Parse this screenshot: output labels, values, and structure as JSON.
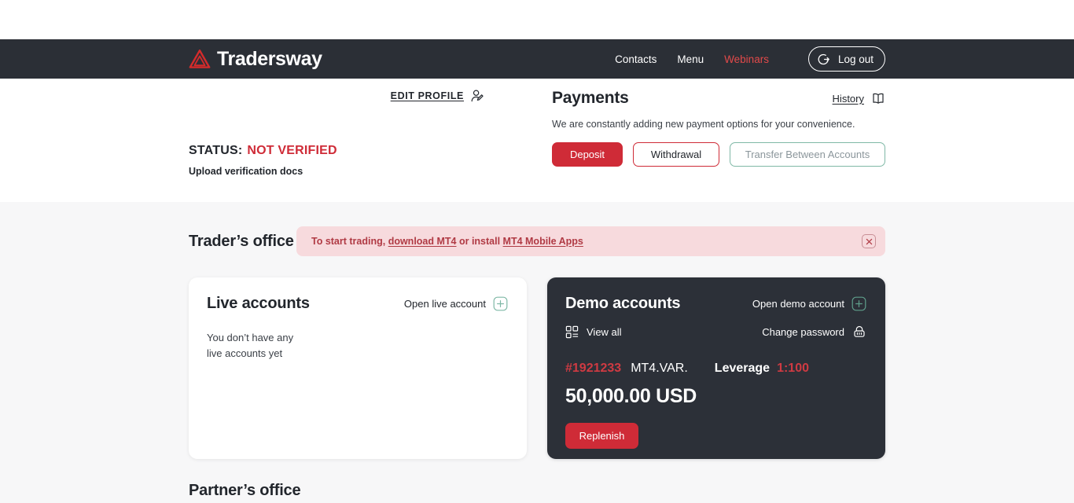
{
  "brand": {
    "name": "Tradersway",
    "logo_icon": "triangle-logo-icon",
    "accent_color": "#cf2b37"
  },
  "header": {
    "background_color": "#2b2f36",
    "nav": [
      {
        "label": "Contacts",
        "accent": false
      },
      {
        "label": "Menu",
        "accent": false
      },
      {
        "label": "Webinars",
        "accent": true
      }
    ],
    "logout": {
      "label": "Log out",
      "icon": "logout-icon"
    }
  },
  "profile": {
    "edit_profile_label": "EDIT PROFILE",
    "edit_profile_icon": "user-edit-icon",
    "status_label": "STATUS:",
    "status_value": "NOT VERIFIED",
    "status_color": "#cf2b37",
    "upload_docs_label": "Upload verification docs"
  },
  "payments": {
    "title": "Payments",
    "description": "We are constantly adding new payment options for your convenience.",
    "history_label": "History",
    "history_icon": "book-icon",
    "buttons": {
      "deposit": "Deposit",
      "withdrawal": "Withdrawal",
      "transfer": "Transfer Between Accounts"
    }
  },
  "traders_office": {
    "title": "Trader’s office",
    "alert": {
      "text_before": "To start trading, ",
      "link1": "download MT4",
      "text_middle": " or install ",
      "link2": "MT4 Mobile Apps",
      "close_icon": "close-icon",
      "background_color": "#f7dadd",
      "text_color": "#b03a44"
    }
  },
  "live_accounts": {
    "title": "Live accounts",
    "open_label": "Open live account",
    "open_icon": "plus-box-icon",
    "empty_line1": "You don’t have any",
    "empty_line2": "live accounts yet"
  },
  "demo_accounts": {
    "title": "Demo accounts",
    "open_label": "Open demo account",
    "open_icon": "plus-box-icon",
    "view_all_label": "View all",
    "view_all_icon": "grid-list-icon",
    "change_password_label": "Change password",
    "change_password_icon": "lock-icon",
    "account": {
      "id": "#1921233",
      "type": "MT4.VAR.",
      "leverage_label": "Leverage",
      "leverage_value": "1:100",
      "balance": "50,000.00 USD",
      "replenish_label": "Replenish"
    },
    "background_color": "#2c3038"
  },
  "partners_office": {
    "title": "Partner’s office"
  }
}
